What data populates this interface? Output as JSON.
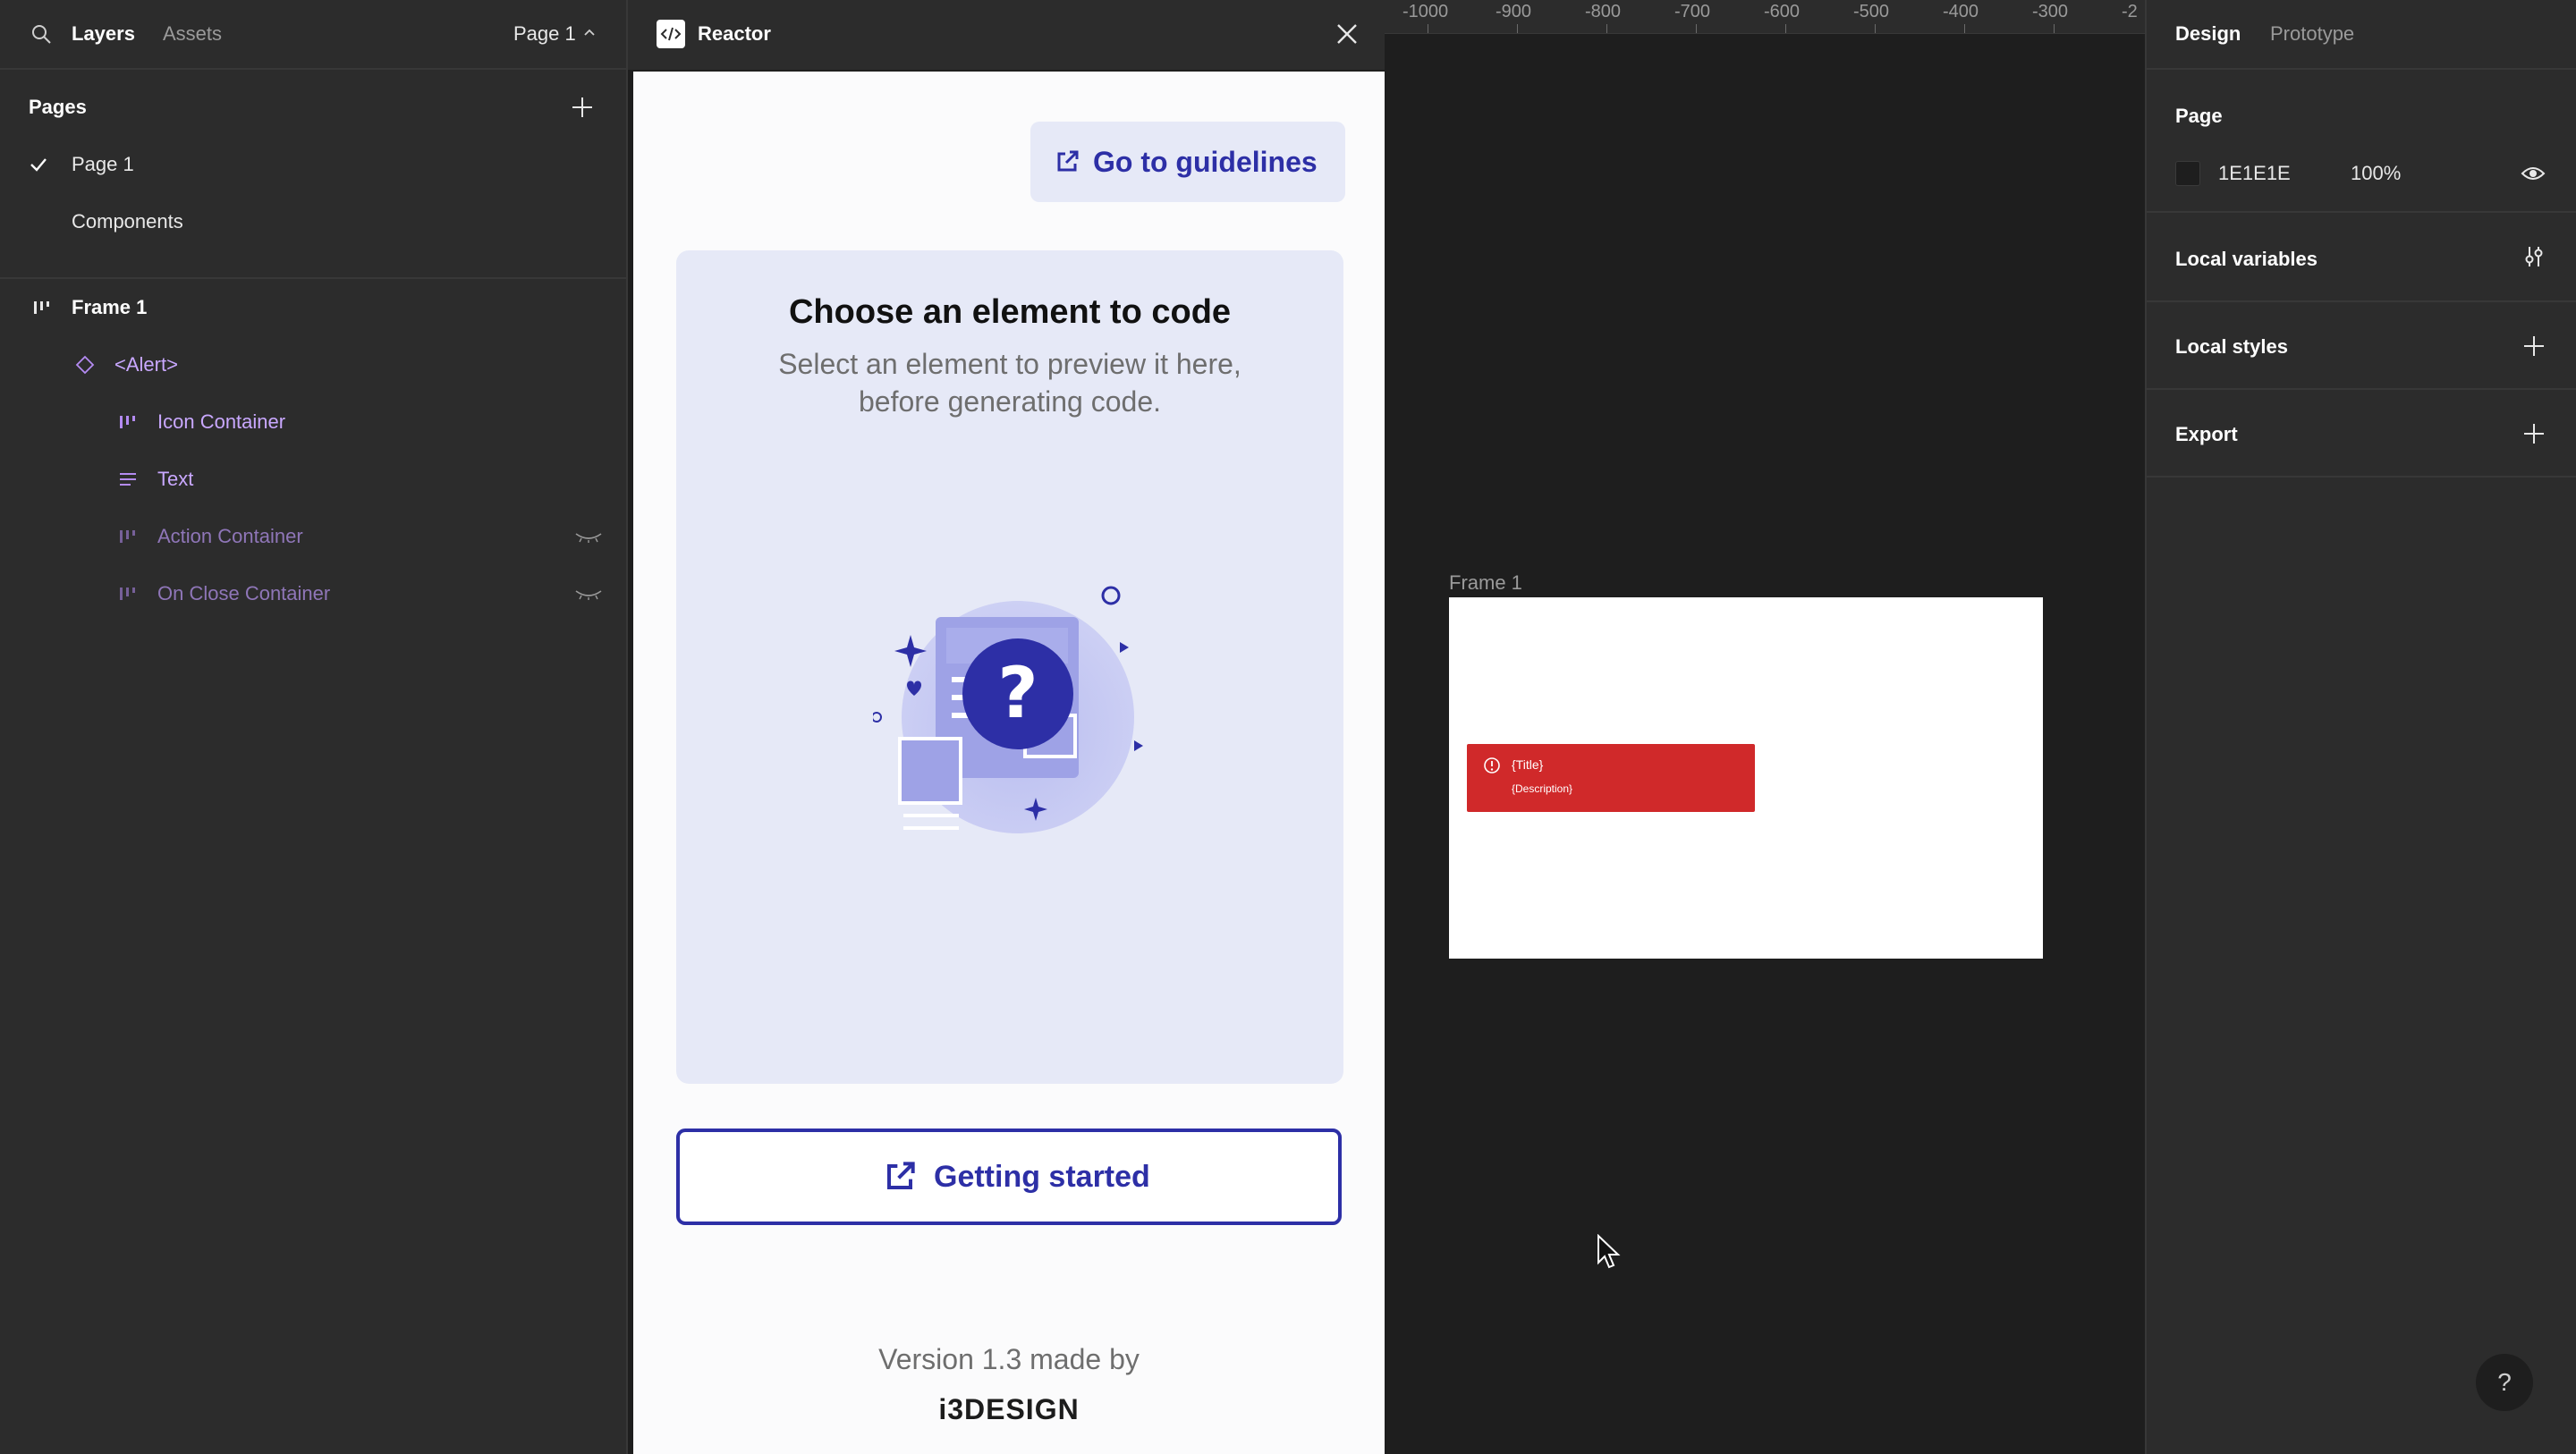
{
  "left_panel": {
    "tabs": {
      "layers": "Layers",
      "assets": "Assets"
    },
    "page_switcher": "Page 1",
    "pages_title": "Pages",
    "pages": [
      {
        "label": "Page 1",
        "selected": true
      },
      {
        "label": "Components",
        "selected": false
      }
    ],
    "layers": [
      {
        "label": "Frame 1",
        "icon": "frame-icon"
      },
      {
        "label": "<Alert>",
        "icon": "component-instance-icon"
      },
      {
        "label": "Icon Container",
        "icon": "auto-layout-icon"
      },
      {
        "label": "Text",
        "icon": "text-layer-icon"
      },
      {
        "label": "Action Container",
        "icon": "auto-layout-icon",
        "hidden": true
      },
      {
        "label": "On Close Container",
        "icon": "auto-layout-icon",
        "hidden": true
      }
    ]
  },
  "plugin": {
    "title": "Reactor",
    "guidelines_label": "Go to guidelines",
    "preview_title": "Choose an element to code",
    "preview_subtitle": "Select an element to preview it here, before generating code.",
    "getting_started_label": "Getting started",
    "version_text": "Version 1.3 made by",
    "brand": "i3DESIGN",
    "accent_color": "#2d2fa6",
    "card_color": "#e6e9f7"
  },
  "canvas": {
    "ruler_ticks": [
      "-1000",
      "-900",
      "-800",
      "-700",
      "-600",
      "-500",
      "-400",
      "-300",
      "-2"
    ],
    "frame_label": "Frame 1",
    "alert": {
      "title": "{Title}",
      "description": "{Description}",
      "color": "#d0292a"
    }
  },
  "right_panel": {
    "tabs": {
      "design": "Design",
      "prototype": "Prototype"
    },
    "page_section": {
      "title": "Page",
      "color_hex": "1E1E1E",
      "opacity": "100%"
    },
    "local_variables": "Local variables",
    "local_styles": "Local styles",
    "export": "Export",
    "help": "?"
  }
}
